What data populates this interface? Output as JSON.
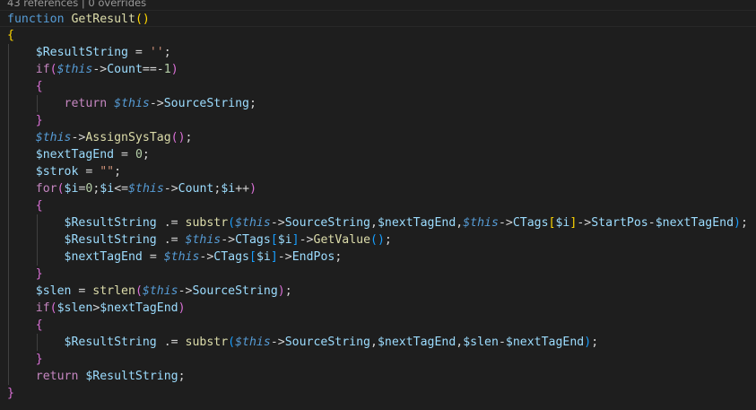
{
  "editor": {
    "codelens": {
      "text": "43 references | 0 overrides"
    },
    "lines": [
      {
        "tokens": [
          {
            "t": "function",
            "c": "kw"
          },
          {
            "t": " ",
            "c": "op"
          },
          {
            "t": "GetResult",
            "c": "fn"
          },
          {
            "t": "()",
            "c": "b1"
          }
        ]
      },
      {
        "tokens": [
          {
            "t": "{",
            "c": "b1"
          }
        ]
      },
      {
        "tokens": [
          {
            "t": "    ",
            "c": "op"
          },
          {
            "t": "$ResultString",
            "c": "var"
          },
          {
            "t": " = ",
            "c": "op"
          },
          {
            "t": "''",
            "c": "str"
          },
          {
            "t": ";",
            "c": "op"
          }
        ]
      },
      {
        "tokens": [
          {
            "t": "    ",
            "c": "op"
          },
          {
            "t": "if",
            "c": "ctl"
          },
          {
            "t": "(",
            "c": "b2"
          },
          {
            "t": "$this",
            "c": "this"
          },
          {
            "t": "->",
            "c": "op"
          },
          {
            "t": "Count",
            "c": "var"
          },
          {
            "t": "==-",
            "c": "op"
          },
          {
            "t": "1",
            "c": "num"
          },
          {
            "t": ")",
            "c": "b2"
          }
        ]
      },
      {
        "tokens": [
          {
            "t": "    ",
            "c": "op"
          },
          {
            "t": "{",
            "c": "b2"
          }
        ]
      },
      {
        "tokens": [
          {
            "t": "        ",
            "c": "op"
          },
          {
            "t": "return",
            "c": "ctl"
          },
          {
            "t": " ",
            "c": "op"
          },
          {
            "t": "$this",
            "c": "this"
          },
          {
            "t": "->",
            "c": "op"
          },
          {
            "t": "SourceString",
            "c": "var"
          },
          {
            "t": ";",
            "c": "op"
          }
        ]
      },
      {
        "tokens": [
          {
            "t": "    ",
            "c": "op"
          },
          {
            "t": "}",
            "c": "b2"
          }
        ]
      },
      {
        "tokens": [
          {
            "t": "    ",
            "c": "op"
          },
          {
            "t": "$this",
            "c": "this"
          },
          {
            "t": "->",
            "c": "op"
          },
          {
            "t": "AssignSysTag",
            "c": "fn"
          },
          {
            "t": "()",
            "c": "b2"
          },
          {
            "t": ";",
            "c": "op"
          }
        ]
      },
      {
        "tokens": [
          {
            "t": "    ",
            "c": "op"
          },
          {
            "t": "$nextTagEnd",
            "c": "var"
          },
          {
            "t": " = ",
            "c": "op"
          },
          {
            "t": "0",
            "c": "num"
          },
          {
            "t": ";",
            "c": "op"
          }
        ]
      },
      {
        "tokens": [
          {
            "t": "    ",
            "c": "op"
          },
          {
            "t": "$strok",
            "c": "var"
          },
          {
            "t": " = ",
            "c": "op"
          },
          {
            "t": "\"\"",
            "c": "str"
          },
          {
            "t": ";",
            "c": "op"
          }
        ]
      },
      {
        "tokens": [
          {
            "t": "    ",
            "c": "op"
          },
          {
            "t": "for",
            "c": "ctl"
          },
          {
            "t": "(",
            "c": "b2"
          },
          {
            "t": "$i",
            "c": "var"
          },
          {
            "t": "=",
            "c": "op"
          },
          {
            "t": "0",
            "c": "num"
          },
          {
            "t": ";",
            "c": "op"
          },
          {
            "t": "$i",
            "c": "var"
          },
          {
            "t": "<=",
            "c": "op"
          },
          {
            "t": "$this",
            "c": "this"
          },
          {
            "t": "->",
            "c": "op"
          },
          {
            "t": "Count",
            "c": "var"
          },
          {
            "t": ";",
            "c": "op"
          },
          {
            "t": "$i",
            "c": "var"
          },
          {
            "t": "++",
            "c": "op"
          },
          {
            "t": ")",
            "c": "b2"
          }
        ]
      },
      {
        "tokens": [
          {
            "t": "    ",
            "c": "op"
          },
          {
            "t": "{",
            "c": "b2"
          }
        ]
      },
      {
        "tokens": [
          {
            "t": "        ",
            "c": "op"
          },
          {
            "t": "$ResultString",
            "c": "var"
          },
          {
            "t": " .= ",
            "c": "op"
          },
          {
            "t": "substr",
            "c": "fn"
          },
          {
            "t": "(",
            "c": "b3"
          },
          {
            "t": "$this",
            "c": "this"
          },
          {
            "t": "->",
            "c": "op"
          },
          {
            "t": "SourceString",
            "c": "var"
          },
          {
            "t": ",",
            "c": "op"
          },
          {
            "t": "$nextTagEnd",
            "c": "var"
          },
          {
            "t": ",",
            "c": "op"
          },
          {
            "t": "$this",
            "c": "this"
          },
          {
            "t": "->",
            "c": "op"
          },
          {
            "t": "CTags",
            "c": "var"
          },
          {
            "t": "[",
            "c": "b1"
          },
          {
            "t": "$i",
            "c": "var"
          },
          {
            "t": "]",
            "c": "b1"
          },
          {
            "t": "->",
            "c": "op"
          },
          {
            "t": "StartPos",
            "c": "var"
          },
          {
            "t": "-",
            "c": "op"
          },
          {
            "t": "$nextTagEnd",
            "c": "var"
          },
          {
            "t": ")",
            "c": "b3"
          },
          {
            "t": ";",
            "c": "op"
          }
        ]
      },
      {
        "tokens": [
          {
            "t": "        ",
            "c": "op"
          },
          {
            "t": "$ResultString",
            "c": "var"
          },
          {
            "t": " .= ",
            "c": "op"
          },
          {
            "t": "$this",
            "c": "this"
          },
          {
            "t": "->",
            "c": "op"
          },
          {
            "t": "CTags",
            "c": "var"
          },
          {
            "t": "[",
            "c": "b3"
          },
          {
            "t": "$i",
            "c": "var"
          },
          {
            "t": "]",
            "c": "b3"
          },
          {
            "t": "->",
            "c": "op"
          },
          {
            "t": "GetValue",
            "c": "fn"
          },
          {
            "t": "()",
            "c": "b3"
          },
          {
            "t": ";",
            "c": "op"
          }
        ]
      },
      {
        "tokens": [
          {
            "t": "        ",
            "c": "op"
          },
          {
            "t": "$nextTagEnd",
            "c": "var"
          },
          {
            "t": " = ",
            "c": "op"
          },
          {
            "t": "$this",
            "c": "this"
          },
          {
            "t": "->",
            "c": "op"
          },
          {
            "t": "CTags",
            "c": "var"
          },
          {
            "t": "[",
            "c": "b3"
          },
          {
            "t": "$i",
            "c": "var"
          },
          {
            "t": "]",
            "c": "b3"
          },
          {
            "t": "->",
            "c": "op"
          },
          {
            "t": "EndPos",
            "c": "var"
          },
          {
            "t": ";",
            "c": "op"
          }
        ]
      },
      {
        "tokens": [
          {
            "t": "    ",
            "c": "op"
          },
          {
            "t": "}",
            "c": "b2"
          }
        ]
      },
      {
        "tokens": [
          {
            "t": "    ",
            "c": "op"
          },
          {
            "t": "$slen",
            "c": "var"
          },
          {
            "t": " = ",
            "c": "op"
          },
          {
            "t": "strlen",
            "c": "fn"
          },
          {
            "t": "(",
            "c": "b2"
          },
          {
            "t": "$this",
            "c": "this"
          },
          {
            "t": "->",
            "c": "op"
          },
          {
            "t": "SourceString",
            "c": "var"
          },
          {
            "t": ")",
            "c": "b2"
          },
          {
            "t": ";",
            "c": "op"
          }
        ]
      },
      {
        "tokens": [
          {
            "t": "    ",
            "c": "op"
          },
          {
            "t": "if",
            "c": "ctl"
          },
          {
            "t": "(",
            "c": "b2"
          },
          {
            "t": "$slen",
            "c": "var"
          },
          {
            "t": ">",
            "c": "op"
          },
          {
            "t": "$nextTagEnd",
            "c": "var"
          },
          {
            "t": ")",
            "c": "b2"
          }
        ]
      },
      {
        "tokens": [
          {
            "t": "    ",
            "c": "op"
          },
          {
            "t": "{",
            "c": "b2"
          }
        ]
      },
      {
        "tokens": [
          {
            "t": "        ",
            "c": "op"
          },
          {
            "t": "$ResultString",
            "c": "var"
          },
          {
            "t": " .= ",
            "c": "op"
          },
          {
            "t": "substr",
            "c": "fn"
          },
          {
            "t": "(",
            "c": "b3"
          },
          {
            "t": "$this",
            "c": "this"
          },
          {
            "t": "->",
            "c": "op"
          },
          {
            "t": "SourceString",
            "c": "var"
          },
          {
            "t": ",",
            "c": "op"
          },
          {
            "t": "$nextTagEnd",
            "c": "var"
          },
          {
            "t": ",",
            "c": "op"
          },
          {
            "t": "$slen",
            "c": "var"
          },
          {
            "t": "-",
            "c": "op"
          },
          {
            "t": "$nextTagEnd",
            "c": "var"
          },
          {
            "t": ")",
            "c": "b3"
          },
          {
            "t": ";",
            "c": "op"
          }
        ]
      },
      {
        "tokens": [
          {
            "t": "    ",
            "c": "op"
          },
          {
            "t": "}",
            "c": "b2"
          }
        ]
      },
      {
        "tokens": [
          {
            "t": "    ",
            "c": "op"
          },
          {
            "t": "return",
            "c": "ctl"
          },
          {
            "t": " ",
            "c": "op"
          },
          {
            "t": "$ResultString",
            "c": "var"
          },
          {
            "t": ";",
            "c": "op"
          }
        ]
      },
      {
        "tokens": [
          {
            "t": "}",
            "c": "b2"
          }
        ]
      }
    ],
    "colors": {
      "background": "#1e1e1e",
      "keyword": "#569cd6",
      "control": "#c586c0",
      "function": "#dcdcaa",
      "variable": "#9cdcfe",
      "string": "#ce9178",
      "number": "#b5cea8",
      "bracket_gold": "#ffd700",
      "bracket_orchid": "#da70d6",
      "bracket_blue": "#179fff"
    }
  }
}
